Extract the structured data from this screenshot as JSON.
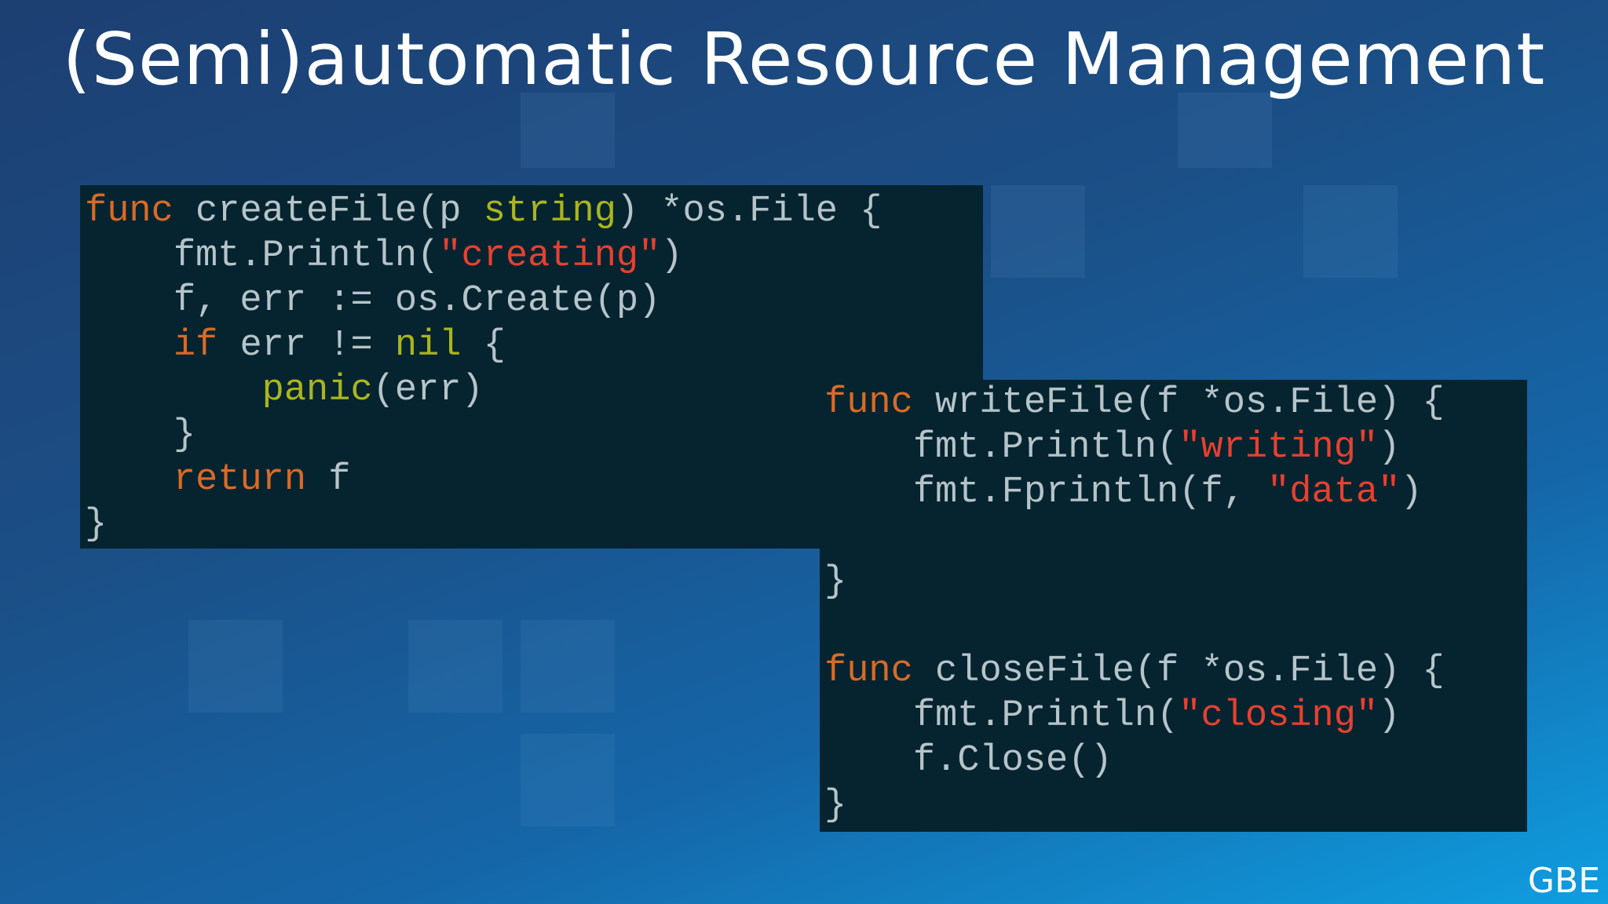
{
  "slide": {
    "title": "(Semi)automatic Resource Management",
    "logo": "GBE"
  },
  "code": {
    "create_file": [
      [
        "func",
        " createFile(p ",
        "string",
        ") *os.File {"
      ],
      [
        "    fmt.Println(",
        "\"creating\"",
        ")"
      ],
      [
        "    f, err := os.Create(p)"
      ],
      [
        "    ",
        "if",
        " err != ",
        "nil",
        " {"
      ],
      [
        "        ",
        "panic",
        "(err)"
      ],
      [
        "    }"
      ],
      [
        "    ",
        "return",
        " f"
      ],
      [
        "}"
      ]
    ],
    "write_file": [
      [
        "func",
        " writeFile(f *os.File) {"
      ],
      [
        "    fmt.Println(",
        "\"writing\"",
        ")"
      ],
      [
        "    fmt.Fprintln(f, ",
        "\"data\"",
        ")"
      ],
      [
        ""
      ],
      [
        "}"
      ]
    ],
    "close_file": [
      [
        "func",
        " closeFile(f *os.File) {"
      ],
      [
        "    fmt.Println(",
        "\"closing\"",
        ")"
      ],
      [
        "    f.Close()"
      ],
      [
        "}"
      ]
    ]
  },
  "colors": {
    "keyword": "#d96a26",
    "type_builtin": "#aab51e",
    "string": "#e7402f",
    "plain": "#b6c4c9",
    "code_background": "#052430"
  }
}
